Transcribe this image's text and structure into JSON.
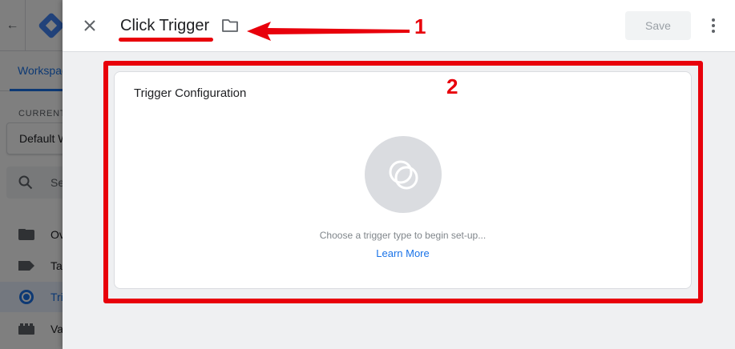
{
  "background_app": {
    "back_icon": "arrow-left-icon",
    "logo_icon": "gtm-logo-icon",
    "tab_label": "Workspace",
    "current_workspace_label": "CURRENT WORKSPACE",
    "workspace_name": "Default Workspace",
    "search_placeholder": "Search",
    "nav": [
      {
        "label": "Overview",
        "icon": "folder-icon"
      },
      {
        "label": "Tags",
        "icon": "tag-icon"
      },
      {
        "label": "Triggers",
        "icon": "trigger-icon",
        "active": true
      },
      {
        "label": "Variables",
        "icon": "variables-icon"
      }
    ]
  },
  "panel": {
    "title": "Click Trigger",
    "close_icon": "close-icon",
    "folder_icon": "folder-outline-icon",
    "save_label": "Save",
    "more_icon": "more-vert-icon",
    "card": {
      "title": "Trigger Configuration",
      "placeholder_icon": "trigger-type-icon",
      "hint": "Choose a trigger type to begin set-up...",
      "link": "Learn More"
    }
  },
  "annotations": [
    {
      "label": "1",
      "color": "#e8000b"
    },
    {
      "label": "2",
      "color": "#e8000b"
    }
  ],
  "colors": {
    "accent": "#1a73e8",
    "annotation": "#e8000b",
    "panel_bg": "#eff0f2"
  }
}
